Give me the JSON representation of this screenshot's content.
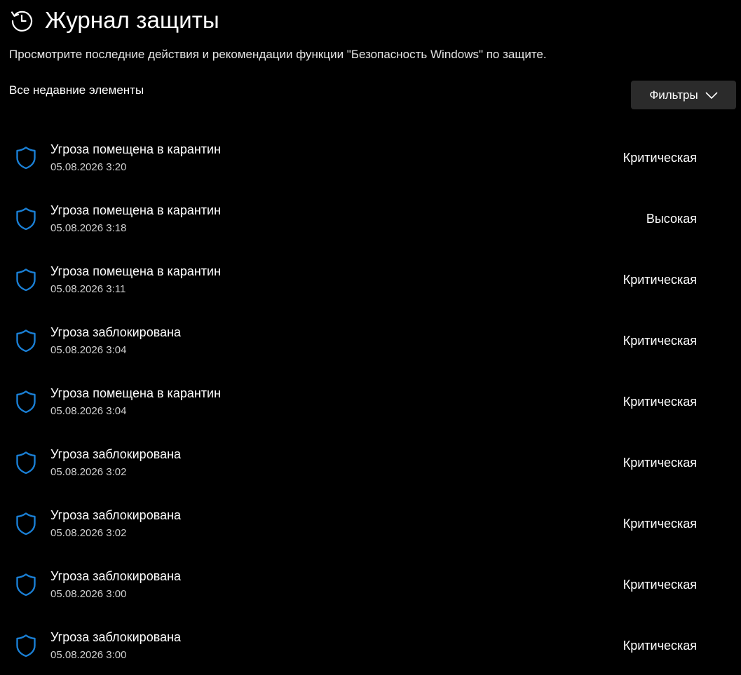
{
  "header": {
    "title": "Журнал защиты",
    "icon": "history-icon"
  },
  "subtitle": "Просмотрите последние действия и рекомендации функции \"Безопасность Windows\" по защите.",
  "section_label": "Все недавние элементы",
  "filters": {
    "label": "Фильтры",
    "icon": "chevron-down-icon"
  },
  "colors": {
    "background": "#000000",
    "accent": "#1a7fd4",
    "button_bg": "#2b2b2b"
  },
  "items": [
    {
      "title": "Угроза помещена в карантин",
      "date": "05.08.2026 3:20",
      "severity": "Критическая",
      "icon": "shield-icon"
    },
    {
      "title": "Угроза помещена в карантин",
      "date": "05.08.2026 3:18",
      "severity": "Высокая",
      "icon": "shield-icon"
    },
    {
      "title": "Угроза помещена в карантин",
      "date": "05.08.2026 3:11",
      "severity": "Критическая",
      "icon": "shield-icon"
    },
    {
      "title": "Угроза заблокирована",
      "date": "05.08.2026 3:04",
      "severity": "Критическая",
      "icon": "shield-icon"
    },
    {
      "title": "Угроза помещена в карантин",
      "date": "05.08.2026 3:04",
      "severity": "Критическая",
      "icon": "shield-icon"
    },
    {
      "title": "Угроза заблокирована",
      "date": "05.08.2026 3:02",
      "severity": "Критическая",
      "icon": "shield-icon"
    },
    {
      "title": "Угроза заблокирована",
      "date": "05.08.2026 3:02",
      "severity": "Критическая",
      "icon": "shield-icon"
    },
    {
      "title": "Угроза заблокирована",
      "date": "05.08.2026 3:00",
      "severity": "Критическая",
      "icon": "shield-icon"
    },
    {
      "title": "Угроза заблокирована",
      "date": "05.08.2026 3:00",
      "severity": "Критическая",
      "icon": "shield-icon"
    }
  ]
}
